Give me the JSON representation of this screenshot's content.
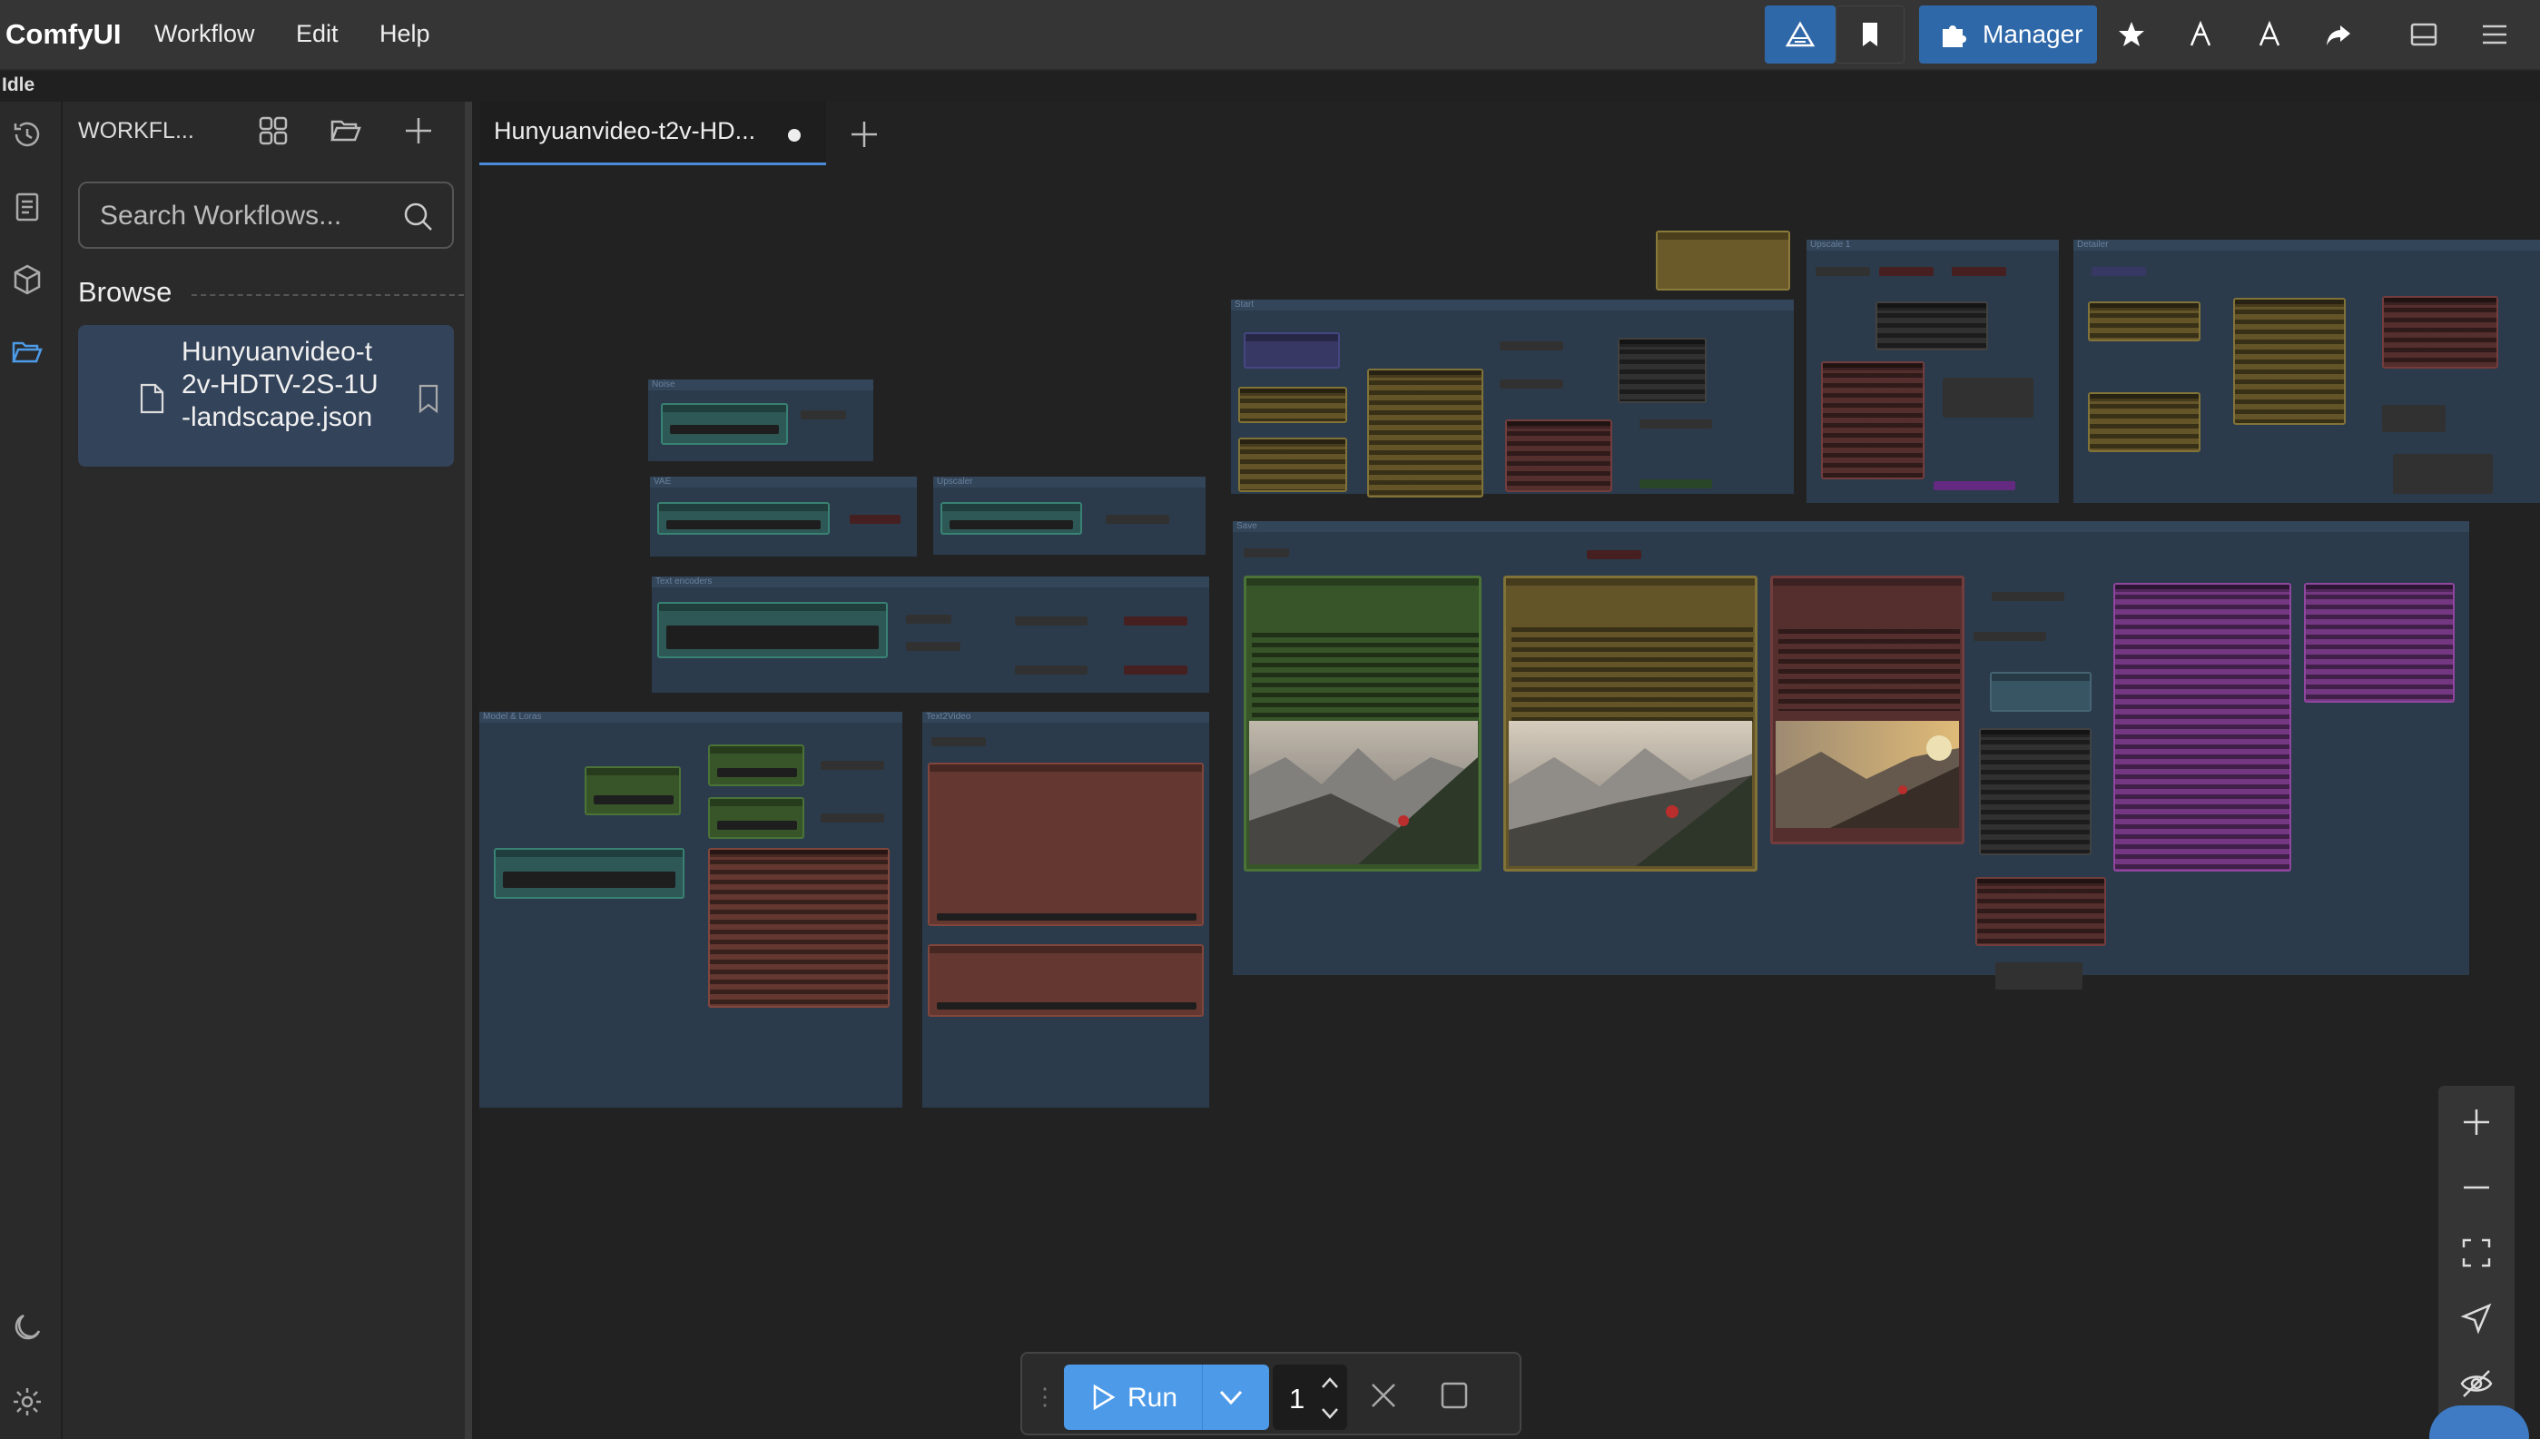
{
  "app": {
    "title": "ComfyUI",
    "status": "Idle"
  },
  "menu": {
    "workflow": "Workflow",
    "edit": "Edit",
    "help": "Help"
  },
  "toolbar": {
    "manager_label": "Manager"
  },
  "sidebar": {
    "title": "WORKFL...",
    "search_placeholder": "Search Workflows...",
    "browse_label": "Browse",
    "files": [
      {
        "name": "Hunyuanvideo-t2v-HDTV-2S-1U-landscape.json"
      }
    ]
  },
  "tabs": [
    {
      "label": "Hunyuanvideo-t2v-HD...",
      "modified": true
    }
  ],
  "canvas": {
    "groups": [
      "Noise",
      "VAE",
      "Upscaler",
      "Text encoders",
      "Model & Loras",
      "Text2Video",
      "Start",
      "Upscale 1",
      "Detailer",
      "Save"
    ]
  },
  "runbar": {
    "run_label": "Run",
    "batch_count": "1"
  },
  "colors": {
    "accent": "#4d9be8",
    "manager": "#2f68a8",
    "canvas": "#222222",
    "group": "#2c3e50"
  }
}
